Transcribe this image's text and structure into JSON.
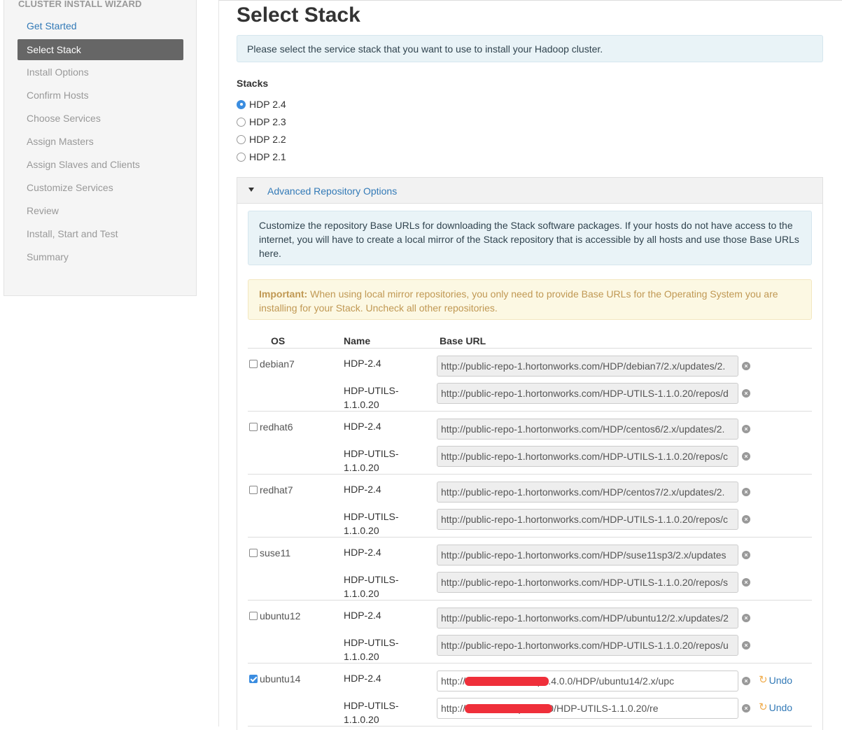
{
  "sidebar": {
    "title": "CLUSTER INSTALL WIZARD",
    "items": [
      {
        "label": "Get Started",
        "state": "done"
      },
      {
        "label": "Select Stack",
        "state": "active"
      },
      {
        "label": "Install Options",
        "state": "pending"
      },
      {
        "label": "Confirm Hosts",
        "state": "pending"
      },
      {
        "label": "Choose Services",
        "state": "pending"
      },
      {
        "label": "Assign Masters",
        "state": "pending"
      },
      {
        "label": "Assign Slaves and Clients",
        "state": "pending"
      },
      {
        "label": "Customize Services",
        "state": "pending"
      },
      {
        "label": "Review",
        "state": "pending"
      },
      {
        "label": "Install, Start and Test",
        "state": "pending"
      },
      {
        "label": "Summary",
        "state": "pending"
      }
    ]
  },
  "main": {
    "title": "Select Stack",
    "info": "Please select the service stack that you want to use to install your Hadoop cluster.",
    "stacks_label": "Stacks",
    "stacks": [
      {
        "label": "HDP 2.4",
        "checked": true
      },
      {
        "label": "HDP 2.3",
        "checked": false
      },
      {
        "label": "HDP 2.2",
        "checked": false
      },
      {
        "label": "HDP 2.1",
        "checked": false
      }
    ]
  },
  "advanced": {
    "title": "Advanced Repository Options",
    "description": "Customize the repository Base URLs for downloading the Stack software packages. If your hosts do not have access to the internet, you will have to create a local mirror of the Stack repository that is accessible by all hosts and use those Base URLs here.",
    "important_label": "Important:",
    "important_text": " When using local mirror repositories, you only need to provide Base URLs for the Operating System you are installing for your Stack. Uncheck all other repositories.",
    "columns": {
      "os": "OS",
      "name": "Name",
      "base_url": "Base URL"
    },
    "undo_label": "Undo",
    "os_list": [
      {
        "os": "debian7",
        "checked": false,
        "repos": [
          {
            "name": "HDP-2.4",
            "url": "http://public-repo-1.hortonworks.com/HDP/debian7/2.x/updates/2.",
            "edited": false
          },
          {
            "name": "HDP-UTILS-1.1.0.20",
            "url": "http://public-repo-1.hortonworks.com/HDP-UTILS-1.1.0.20/repos/d",
            "edited": false
          }
        ]
      },
      {
        "os": "redhat6",
        "checked": false,
        "repos": [
          {
            "name": "HDP-2.4",
            "url": "http://public-repo-1.hortonworks.com/HDP/centos6/2.x/updates/2.",
            "edited": false
          },
          {
            "name": "HDP-UTILS-1.1.0.20",
            "url": "http://public-repo-1.hortonworks.com/HDP-UTILS-1.1.0.20/repos/c",
            "edited": false
          }
        ]
      },
      {
        "os": "redhat7",
        "checked": false,
        "repos": [
          {
            "name": "HDP-2.4",
            "url": "http://public-repo-1.hortonworks.com/HDP/centos7/2.x/updates/2.",
            "edited": false
          },
          {
            "name": "HDP-UTILS-1.1.0.20",
            "url": "http://public-repo-1.hortonworks.com/HDP-UTILS-1.1.0.20/repos/c",
            "edited": false
          }
        ]
      },
      {
        "os": "suse11",
        "checked": false,
        "repos": [
          {
            "name": "HDP-2.4",
            "url": "http://public-repo-1.hortonworks.com/HDP/suse11sp3/2.x/updates",
            "edited": false
          },
          {
            "name": "HDP-UTILS-1.1.0.20",
            "url": "http://public-repo-1.hortonworks.com/HDP-UTILS-1.1.0.20/repos/s",
            "edited": false
          }
        ]
      },
      {
        "os": "ubuntu12",
        "checked": false,
        "repos": [
          {
            "name": "HDP-2.4",
            "url": "http://public-repo-1.hortonworks.com/HDP/ubuntu12/2.x/updates/2",
            "edited": false
          },
          {
            "name": "HDP-UTILS-1.1.0.20",
            "url": "http://public-repo-1.hortonworks.com/HDP-UTILS-1.1.0.20/repos/u",
            "edited": false
          }
        ]
      },
      {
        "os": "ubuntu14",
        "checked": true,
        "repos": [
          {
            "name": "HDP-2.4",
            "url": "http://                               .che-inc.com/hdp2.4.0.0/HDP/ubuntu14/2.x/upc",
            "edited": true
          },
          {
            "name": "HDP-UTILS-1.1.0.20",
            "url": "http://                               .inc.com/hdp2.4.0.0/HDP-UTILS-1.1.0.20/re",
            "edited": true
          }
        ]
      }
    ]
  }
}
